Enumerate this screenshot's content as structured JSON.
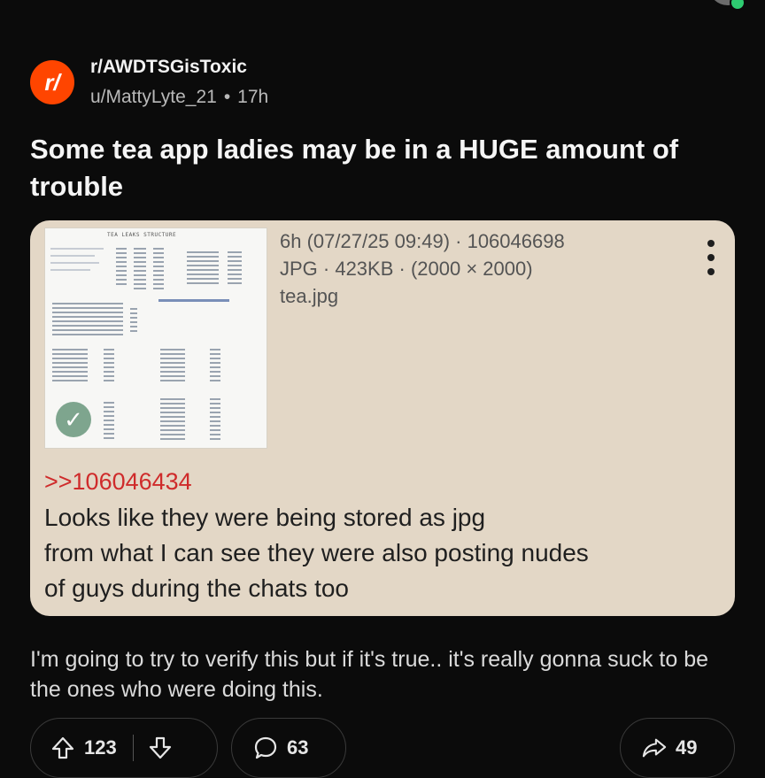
{
  "post": {
    "subreddit": "r/AWDTSGisToxic",
    "subreddit_icon_text": "r/",
    "author": "u/MattyLyte_21",
    "separator": "•",
    "age": "17h",
    "title": "Some tea app ladies may be in a HUGE amount of trouble",
    "body": "I'm going to try to verify this but if it's true.. it's really gonna suck to be the ones who were doing this."
  },
  "image_card": {
    "thumbnail_caption": "TEA LEAKS STRUCTURE",
    "meta_line1": "6h (07/27/25 09:49) · 106046698",
    "meta_line2": "JPG · 423KB · (2000 × 2000)",
    "filename": "tea.jpg",
    "reply_link": ">>106046434",
    "quote_lines": [
      "Looks like they were being stored as jpg",
      "from what I can see they were also posting nudes",
      "of guys during the chats too"
    ],
    "background_color": "#e3d7c6",
    "link_color": "#cf2b2b"
  },
  "actions": {
    "upvotes": "123",
    "comments": "63",
    "shares": "49"
  },
  "icons": {
    "upvote": "arrow-up-icon",
    "downvote": "arrow-down-icon",
    "comment": "comment-bubble-icon",
    "share": "share-arrow-icon",
    "more": "kebab-menu-icon",
    "verified": "check-icon"
  },
  "colors": {
    "brand": "#ff4500",
    "background": "#0b0b0b"
  }
}
